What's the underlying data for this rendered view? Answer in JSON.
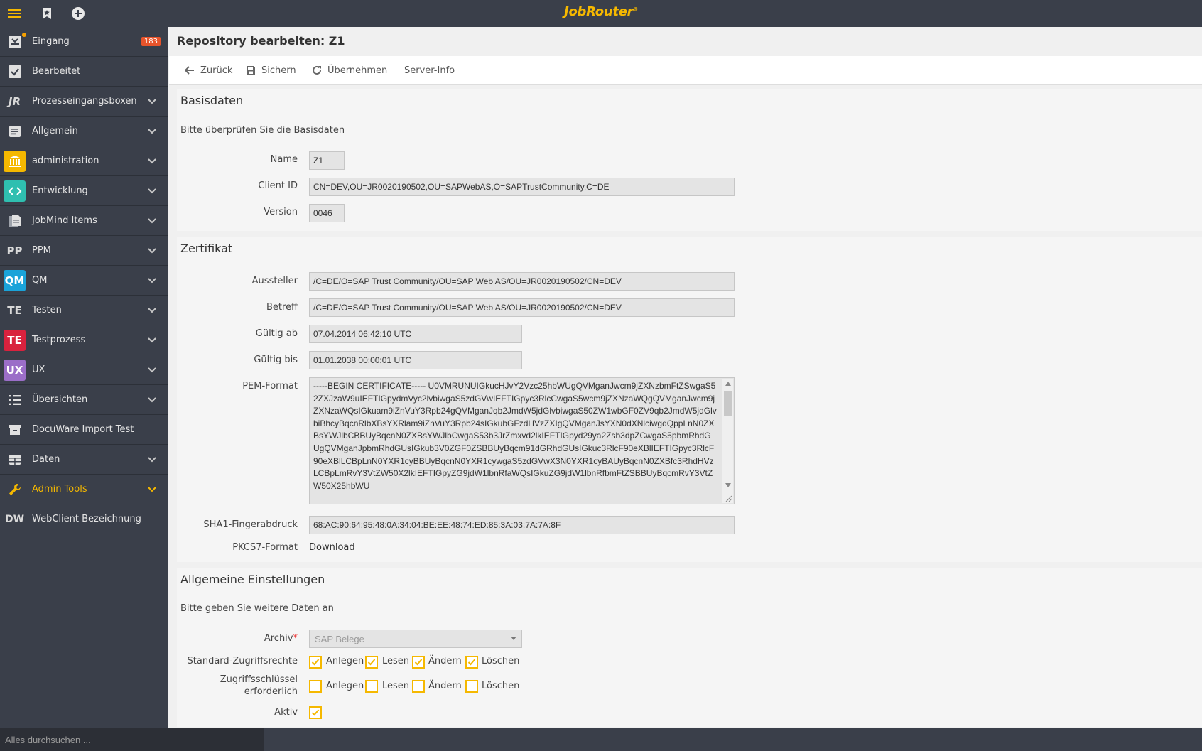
{
  "brand": {
    "name": "JobRouter",
    "mark": "®"
  },
  "search": {
    "placeholder": "Alles durchsuchen ..."
  },
  "sidebar": {
    "items": [
      {
        "label": "Eingang",
        "badge": "183"
      },
      {
        "label": "Bearbeitet"
      },
      {
        "label": "Prozesseingangsboxen",
        "icon_text": "JR"
      },
      {
        "label": "Allgemein"
      },
      {
        "label": "administration"
      },
      {
        "label": "Entwicklung"
      },
      {
        "label": "JobMind Items"
      },
      {
        "label": "PPM",
        "icon_text": "PP"
      },
      {
        "label": "QM",
        "icon_text": "QM"
      },
      {
        "label": "Testen",
        "icon_text": "TE"
      },
      {
        "label": "Testprozess",
        "icon_text": "TE"
      },
      {
        "label": "UX",
        "icon_text": "UX"
      },
      {
        "label": "Übersichten"
      },
      {
        "label": "DocuWare Import Test"
      },
      {
        "label": "Daten"
      },
      {
        "label": "Admin Tools"
      },
      {
        "label": "WebClient Bezeichnung",
        "icon_text": "DW"
      }
    ]
  },
  "colors": {
    "accent": "#f5b800",
    "sidebar_bg": "#3a3f4a",
    "badge": "#e8542b",
    "qm": "#1aa3d9",
    "testprozess": "#d9223e",
    "ux": "#9b6ec8",
    "admin": "#f5b800",
    "entwicklung": "#2fbfb0"
  },
  "page": {
    "title": "Repository bearbeiten: Z1"
  },
  "toolbar": {
    "back": "Zurück",
    "save": "Sichern",
    "apply": "Übernehmen",
    "server_info": "Server-Info"
  },
  "basis": {
    "title": "Basisdaten",
    "desc": "Bitte überprüfen Sie die Basisdaten",
    "name_label": "Name",
    "name": "Z1",
    "client_label": "Client ID",
    "client": "CN=DEV,OU=JR0020190502,OU=SAPWebAS,O=SAPTrustCommunity,C=DE",
    "version_label": "Version",
    "version": "0046"
  },
  "cert": {
    "title": "Zertifikat",
    "issuer_label": "Aussteller",
    "issuer": "/C=DE/O=SAP Trust Community/OU=SAP Web AS/OU=JR0020190502/CN=DEV",
    "subject_label": "Betreff",
    "subject": "/C=DE/O=SAP Trust Community/OU=SAP Web AS/OU=JR0020190502/CN=DEV",
    "valid_from_label": "Gültig ab",
    "valid_from": "07.04.2014 06:42:10 UTC",
    "valid_to_label": "Gültig bis",
    "valid_to": "01.01.2038 00:00:01 UTC",
    "pem_label": "PEM-Format",
    "pem": "-----BEGIN CERTIFICATE----- U0VMRUNUIGkucHJvY2Vzc25hbWUgQVMganJwcm9jZXNzbmFtZSwgaS52ZXJzaW9uIEFTIGpydmVyc2lvbiwgaS5zdGVwIEFTIGpyc3RlcCwgaS5wcm9jZXNzaWQgQVMganJwcm9jZXNzaWQsIGkuam9iZnVuY3Rpb24gQVMganJqb2JmdW5jdGlvbiwgaS50ZW1wbGF0ZV9qb2JmdW5jdGlvbiBhcyBqcnRlbXBsYXRlam9iZnVuY3Rpb24sIGkubGFzdHVzZXIgQVMganJsYXN0dXNlciwgdQppLnN0ZXBsYWJlbCBBUyBqcnN0ZXBsYWJlbCwgaS53b3JrZmxvd2lkIEFTIGpyd29ya2Zsb3dpZCwgaS5pbmRhdGUgQVMganJpbmRhdGUsIGkub3V0ZGF0ZSBBUyBqcm91dGRhdGUsIGkuc3RlcF90eXBlIEFTIGpyc3RlcF90eXBlLCBpLnN0YXR1cyBBUyBqcnN0YXR1cywgaS5zdGVwX3N0YXR1cyBAUyBqcnN0ZXBfc3RhdHVzLCBpLmRvY3VtZW50X2lkIEFTIGpyZG9jdW1lbnRfaWQsIGkuZG9jdW1lbnRfbmFtZSBBUyBqcmRvY3VtZW50X25hbWU=",
    "sha1_label": "SHA1-Fingerabdruck",
    "sha1": "68:AC:90:64:95:48:0A:34:04:BE:EE:48:74:ED:85:3A:03:7A:7A:8F",
    "pkcs7_label": "PKCS7-Format",
    "pkcs7_link": "Download"
  },
  "general": {
    "title": "Allgemeine Einstellungen",
    "desc": "Bitte geben Sie weitere Daten an",
    "archive_label": "Archiv",
    "archive_required": "*",
    "archive_value": "SAP Belege",
    "std_rights_label": "Standard-Zugriffsrechte",
    "key_required_label_1": "Zugriffsschlüssel",
    "key_required_label_2": "erforderlich",
    "active_label": "Aktiv",
    "rights": [
      "Anlegen",
      "Lesen",
      "Ändern",
      "Löschen"
    ],
    "std_checked": [
      true,
      true,
      true,
      true
    ],
    "key_checked": [
      false,
      false,
      false,
      false
    ],
    "active_checked": true
  }
}
